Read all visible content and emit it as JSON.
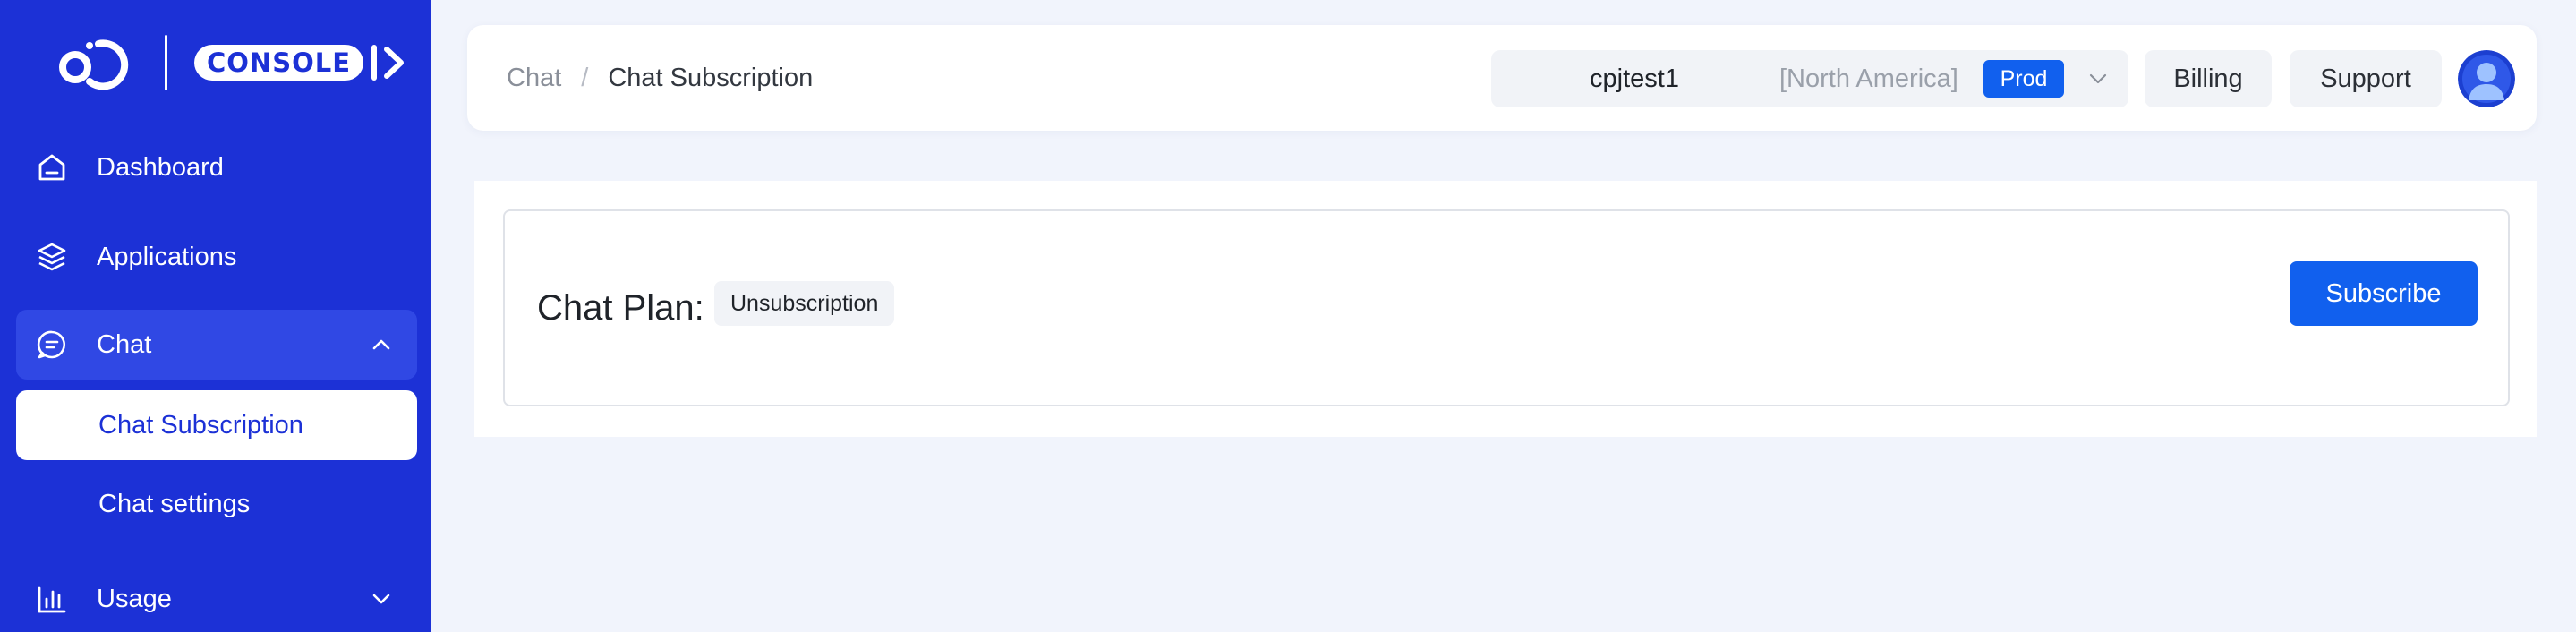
{
  "brand": {
    "logo_text": "CONSOLE"
  },
  "sidebar": {
    "items": [
      {
        "label": "Dashboard",
        "icon": "home-icon"
      },
      {
        "label": "Applications",
        "icon": "layers-icon"
      },
      {
        "label": "Chat",
        "icon": "chat-icon",
        "expanded": true,
        "children": [
          {
            "label": "Chat Subscription",
            "active": true
          },
          {
            "label": "Chat settings",
            "active": false
          }
        ]
      },
      {
        "label": "Usage",
        "icon": "bar-chart-icon",
        "expanded": false
      }
    ]
  },
  "header": {
    "breadcrumb": {
      "parent": "Chat",
      "separator": "/",
      "current": "Chat Subscription"
    },
    "account": {
      "name": "cpjtest1",
      "region": "[North America]",
      "env": "Prod"
    },
    "billing_label": "Billing",
    "support_label": "Support"
  },
  "main": {
    "plan_label": "Chat Plan:",
    "plan_status": "Unsubscription",
    "subscribe_label": "Subscribe"
  },
  "colors": {
    "sidebar_bg": "#1c31d6",
    "accent": "#1160ee",
    "page_bg": "#f1f4fc"
  }
}
